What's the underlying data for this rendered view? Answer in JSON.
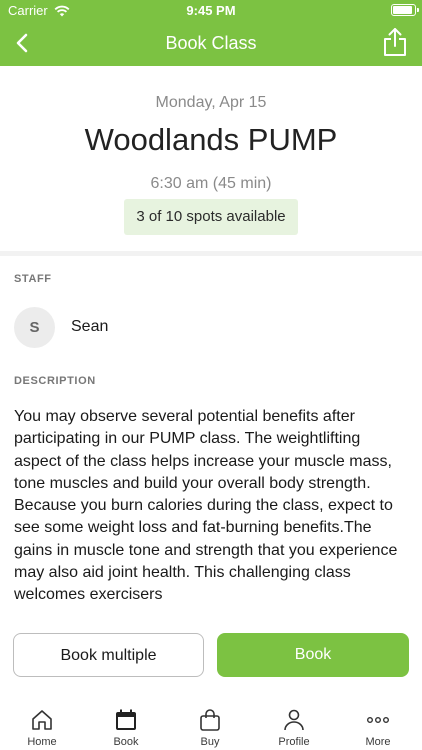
{
  "status_bar": {
    "carrier": "Carrier",
    "time": "9:45 PM"
  },
  "nav": {
    "title": "Book Class"
  },
  "class": {
    "date": "Monday, Apr 15",
    "name": "Woodlands PUMP",
    "time": "6:30 am (45 min)",
    "spots": "3 of 10 spots available"
  },
  "staff": {
    "label": "STAFF",
    "initial": "S",
    "name": "Sean"
  },
  "description": {
    "label": "DESCRIPTION",
    "text": "You may observe several potential benefits after participating in our PUMP class. The weightlifting aspect of the class helps increase your muscle mass, tone muscles and build your overall body strength. Because you burn calories during the class, expect to see some weight loss and fat-burning benefits.The gains in muscle tone and strength that you experience may also aid joint health. This challenging class welcomes exercisers"
  },
  "actions": {
    "book_multiple": "Book multiple",
    "book": "Book"
  },
  "tabs": [
    {
      "label": "Home",
      "icon": "home-icon"
    },
    {
      "label": "Book",
      "icon": "calendar-icon"
    },
    {
      "label": "Buy",
      "icon": "bag-icon"
    },
    {
      "label": "Profile",
      "icon": "person-icon"
    },
    {
      "label": "More",
      "icon": "more-icon"
    }
  ],
  "colors": {
    "brand": "#7cc242",
    "spots_bg": "#e7f3df"
  }
}
